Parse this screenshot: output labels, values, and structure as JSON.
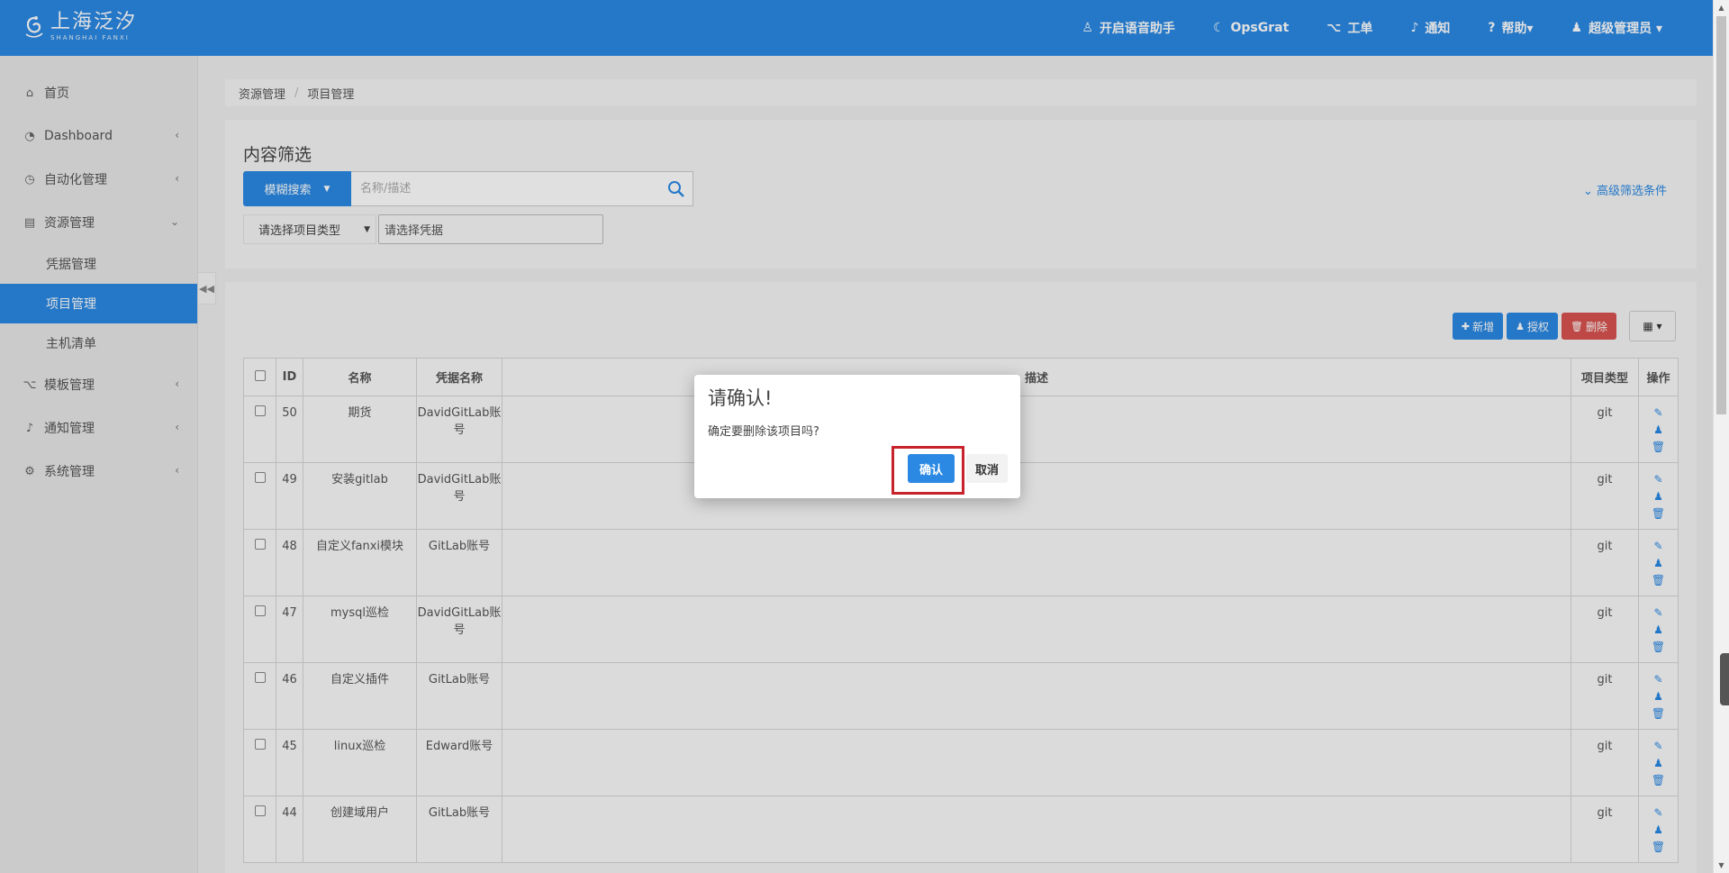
{
  "brand": {
    "name": "上海泛汐",
    "sub": "SHANGHAI FANXI"
  },
  "topnav": [
    {
      "icon": "robot-icon",
      "glyph": "♙",
      "label": "开启语音助手"
    },
    {
      "icon": "opsgrat-logo-icon",
      "glyph": "☾",
      "label": "OpsGrat"
    },
    {
      "icon": "sitemap-icon",
      "glyph": "⌥",
      "label": "工单"
    },
    {
      "icon": "bell-icon",
      "glyph": "♪",
      "label": "通知"
    },
    {
      "icon": "question-circle-icon",
      "glyph": "?",
      "label": "帮助▾"
    },
    {
      "icon": "user-icon",
      "glyph": "♟",
      "label": "超级管理员 ▾"
    }
  ],
  "sidebar": {
    "items": [
      {
        "label": "首页",
        "glyph": "⌂",
        "icon": "home-icon",
        "chevron": ""
      },
      {
        "label": "Dashboard",
        "glyph": "◔",
        "icon": "dashboard-icon",
        "chevron": "‹"
      },
      {
        "label": "自动化管理",
        "glyph": "◷",
        "icon": "clock-icon",
        "chevron": "‹"
      },
      {
        "label": "资源管理",
        "glyph": "▤",
        "icon": "book-icon",
        "chevron": "⌄"
      },
      {
        "label": "模板管理",
        "glyph": "⌥",
        "icon": "sitemap-icon",
        "chevron": "‹"
      },
      {
        "label": "通知管理",
        "glyph": "♪",
        "icon": "bell-icon",
        "chevron": "‹"
      },
      {
        "label": "系统管理",
        "glyph": "⚙",
        "icon": "gear-icon",
        "chevron": "‹"
      }
    ],
    "sub_items": [
      "凭据管理",
      "项目管理",
      "主机清单"
    ]
  },
  "breadcrumb": [
    "资源管理",
    "项目管理"
  ],
  "filter": {
    "title": "内容筛选",
    "search_button": "模糊搜索",
    "search_placeholder": "名称/描述",
    "advanced": "高级筛选条件",
    "type_select": "请选择项目类型",
    "cred_select": "请选择凭据"
  },
  "toolbar": {
    "add": "新增",
    "auth": "授权",
    "delete": "删除"
  },
  "table": {
    "headers": [
      "ID",
      "名称",
      "凭据名称",
      "描述",
      "项目类型",
      "操作"
    ],
    "rows": [
      {
        "id": "50",
        "name": "期货",
        "cred": "DavidGitLab账号",
        "desc": "",
        "type": "git"
      },
      {
        "id": "49",
        "name": "安装gitlab",
        "cred": "DavidGitLab账号",
        "desc": "",
        "type": "git"
      },
      {
        "id": "48",
        "name": "自定义fanxi模块",
        "cred": "GitLab账号",
        "desc": "",
        "type": "git"
      },
      {
        "id": "47",
        "name": "mysql巡检",
        "cred": "DavidGitLab账号",
        "desc": "",
        "type": "git"
      },
      {
        "id": "46",
        "name": "自定义插件",
        "cred": "GitLab账号",
        "desc": "",
        "type": "git"
      },
      {
        "id": "45",
        "name": "linux巡检",
        "cred": "Edward账号",
        "desc": "",
        "type": "git"
      },
      {
        "id": "44",
        "name": "创建域用户",
        "cred": "GitLab账号",
        "desc": "",
        "type": "git"
      }
    ]
  },
  "modal": {
    "title": "请确认!",
    "body": "确定要删除该项目吗?",
    "confirm": "确认",
    "cancel": "取消"
  },
  "colors": {
    "primary": "#2b89e4",
    "danger": "#d9534f",
    "highlight": "#c8232c"
  }
}
